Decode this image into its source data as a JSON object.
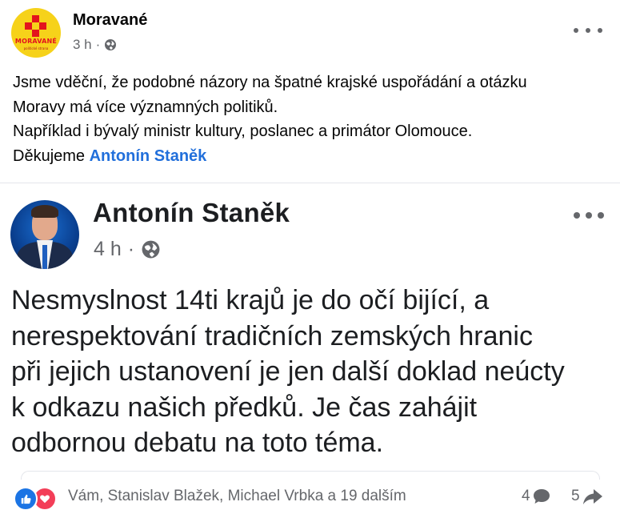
{
  "post": {
    "page_name": "Moravané",
    "avatar_brand": "MORAVANÉ",
    "avatar_brand_sub": "politické strana",
    "time": "3 h",
    "separator": "·",
    "privacy_icon": "globe-icon",
    "more_icon": "more-options-icon",
    "text_lines": [
      "Jsme vděční, že podobné názory na špatné krajské uspořádání a otázku",
      "Moravy má více významných politiků.",
      "Například i bývalý ministr kultury, poslanec a primátor Olomouce."
    ],
    "thanks_prefix": "Děkujeme ",
    "mention": "Antonín Staněk"
  },
  "shared_post": {
    "author": "Antonín Staněk",
    "time": "4 h",
    "separator": "·",
    "privacy_icon": "globe-icon",
    "text_lines": [
      "Nesmyslnost 14ti krajů je do očí bijící, a",
      "nerespektování tradičních zemských hranic",
      "při jejich ustanovení je jen další doklad neúcty",
      "k odkazu našich předků. Je čas zahájit",
      "odbornou debatu na toto téma."
    ]
  },
  "reactions": {
    "icons": [
      "like-icon",
      "love-icon"
    ],
    "summary": "Vám, Stanislav Blažek, Michael Vrbka a 19 dalším",
    "comments": "4",
    "shares": "5"
  },
  "colors": {
    "mention": "#216fdb",
    "like": "#1b74e4",
    "love": "#f33e58",
    "secondary_text": "#65676b"
  }
}
